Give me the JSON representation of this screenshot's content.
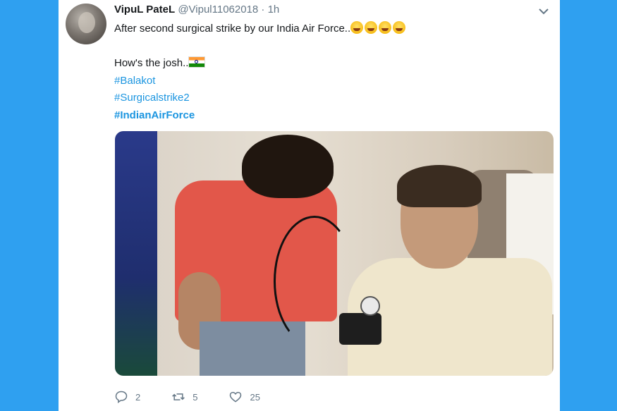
{
  "tweet": {
    "author_name": "VipuL PateL",
    "handle": "@Vipul11062018",
    "separator": "·",
    "time": "1h",
    "text_line1": "After second surgical strike by our India Air Force..",
    "text_line2": "How's the josh..",
    "hashtags": [
      "#Balakot",
      "#Surgicalstrike2",
      "#IndianAirForce"
    ],
    "emoji_line1": [
      "joy-emoji",
      "joy-emoji",
      "sweat-smile-emoji",
      "sweat-smile-emoji"
    ],
    "emoji_line2": [
      "india-flag-emoji"
    ]
  },
  "actions": {
    "reply_count": "2",
    "retweet_count": "5",
    "like_count": "25",
    "icons": [
      "reply-icon",
      "retweet-icon",
      "like-icon"
    ]
  },
  "colors": {
    "background": "#2fa0f0",
    "card": "#ffffff",
    "link": "#1b95e0",
    "muted": "#657786",
    "text": "#14171a"
  }
}
